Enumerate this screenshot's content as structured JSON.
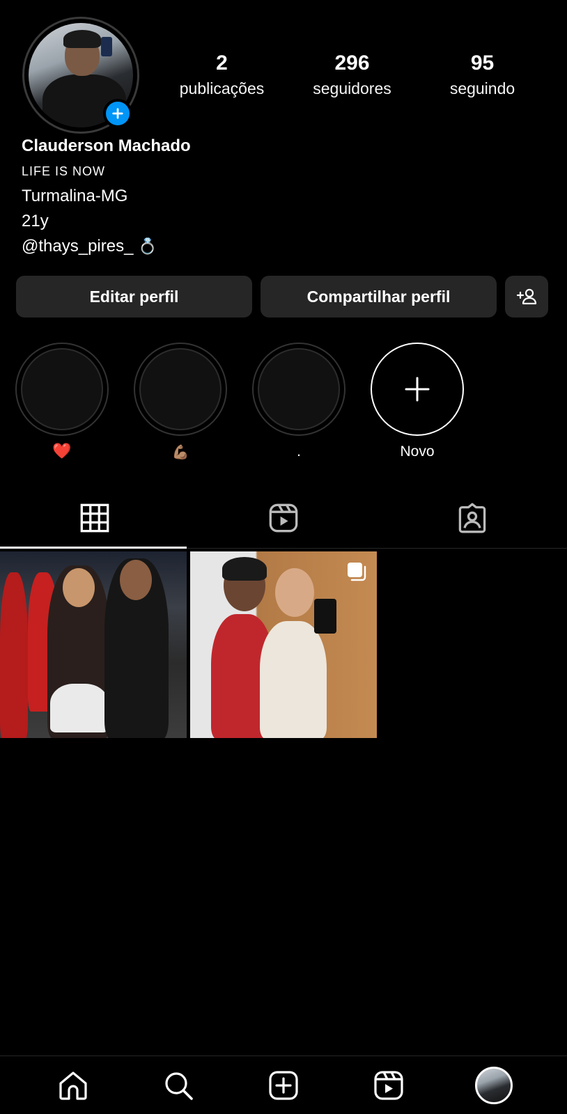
{
  "profile": {
    "name": "Clauderson Machado",
    "bio_caps": "LIFE IS NOW",
    "location": "Turmalina-MG",
    "age": "21y",
    "mention": "@thays_pires_",
    "mention_emoji": "💍"
  },
  "stats": [
    {
      "value": "2",
      "label": "publicações"
    },
    {
      "value": "296",
      "label": "seguidores"
    },
    {
      "value": "95",
      "label": "seguindo"
    }
  ],
  "buttons": {
    "edit_profile": "Editar perfil",
    "share_profile": "Compartilhar perfil"
  },
  "highlights": [
    {
      "label": "❤️",
      "icon": "heart-icon"
    },
    {
      "label": "💪🏽",
      "icon": "flexed-biceps-icon"
    },
    {
      "label": ".",
      "icon": ""
    },
    {
      "label": "Novo",
      "icon": "plus-icon"
    }
  ],
  "tabs": [
    {
      "name": "grid",
      "icon": "grid-icon",
      "active": true
    },
    {
      "name": "reels",
      "icon": "reels-icon",
      "active": false
    },
    {
      "name": "tagged",
      "icon": "tagged-person-icon",
      "active": false
    }
  ],
  "posts": [
    {
      "type": "photo",
      "icon": ""
    },
    {
      "type": "carousel",
      "icon": "carousel-icon"
    }
  ],
  "bottom_nav": [
    {
      "name": "home",
      "icon": "home-icon"
    },
    {
      "name": "search",
      "icon": "search-icon"
    },
    {
      "name": "create",
      "icon": "create-post-icon"
    },
    {
      "name": "reels",
      "icon": "reels-icon"
    },
    {
      "name": "profile",
      "icon": "profile-avatar"
    }
  ],
  "colors": {
    "background": "#000000",
    "button_bg": "#262626",
    "accent_blue": "#0095f6",
    "heart_red": "#e0364a"
  }
}
